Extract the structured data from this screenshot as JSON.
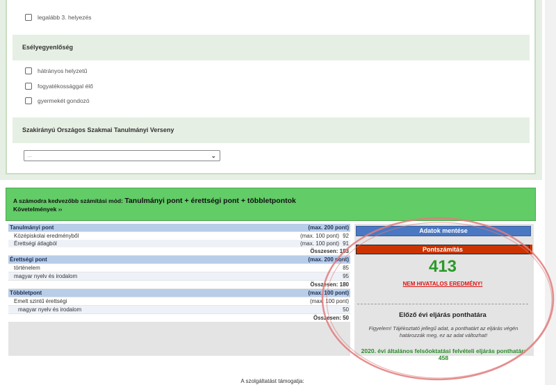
{
  "form": {
    "placement_option": "legalább 3. helyezés",
    "equal_opportunity": {
      "title": "Esélyegyenlőség",
      "options": [
        "hátrányos helyzetű",
        "fogyatékossággal élő",
        "gyermekét gondozó"
      ]
    },
    "competition": {
      "title": "Szakirányú Országos Szakmai Tanulmányi Verseny",
      "select_value": "..."
    }
  },
  "banner": {
    "prefix": "A számodra kedvezőbb számítási mód:",
    "mode": "Tanulmányi pont + érettségi pont + többletpontok",
    "requirements_link": "Követelmények ››"
  },
  "calc": {
    "study": {
      "title": "Tanulmányi pont",
      "max": "(max. 200 pont)",
      "rows": [
        {
          "label": "Középiskolai eredményből",
          "max": "(max. 100 pont)",
          "value": "92"
        },
        {
          "label": "Érettségi átlagból",
          "max": "(max. 100 pont)",
          "value": "91"
        }
      ],
      "total": "Összesen: 183"
    },
    "exam": {
      "title": "Érettségi pont",
      "max": "(max. 200 pont)",
      "rows": [
        {
          "label": "történelem",
          "value": "85"
        },
        {
          "label": "magyar nyelv és irodalom",
          "value": "95"
        }
      ],
      "total": "Összesen: 180"
    },
    "extra": {
      "title": "Többletpont",
      "max": "(max. 100 pont)",
      "sub_title": "Emelt szintű érettségi",
      "sub_max": "(max. 100 pont)",
      "rows": [
        {
          "label": "magyar nyelv és irodalom",
          "value": "50"
        }
      ],
      "total": "Összesen: 50"
    }
  },
  "side": {
    "save_button": "Adatok mentése",
    "calc_button": "Pontszámítás",
    "score": "413",
    "unofficial": "NEM HIVATALOS EREDMÉNY!",
    "prev_title": "Előző évi eljárás ponthatára",
    "warning": "Figyelem! Tájékoztató jellegű adat, a ponthatárt az eljárás végén határozzák meg, ez az adat változhat!",
    "threshold": "2020. évi általános felsőoktatási felvételi eljárás ponthatár: 458"
  },
  "footer": {
    "support": "A szolgáltatást támogatja:"
  },
  "colors": {
    "banner": "#62cc67",
    "save_button": "#4a78c2",
    "calc_button": "#cc3300",
    "score": "#2a9a2a",
    "annotation": "#e07b7b"
  }
}
